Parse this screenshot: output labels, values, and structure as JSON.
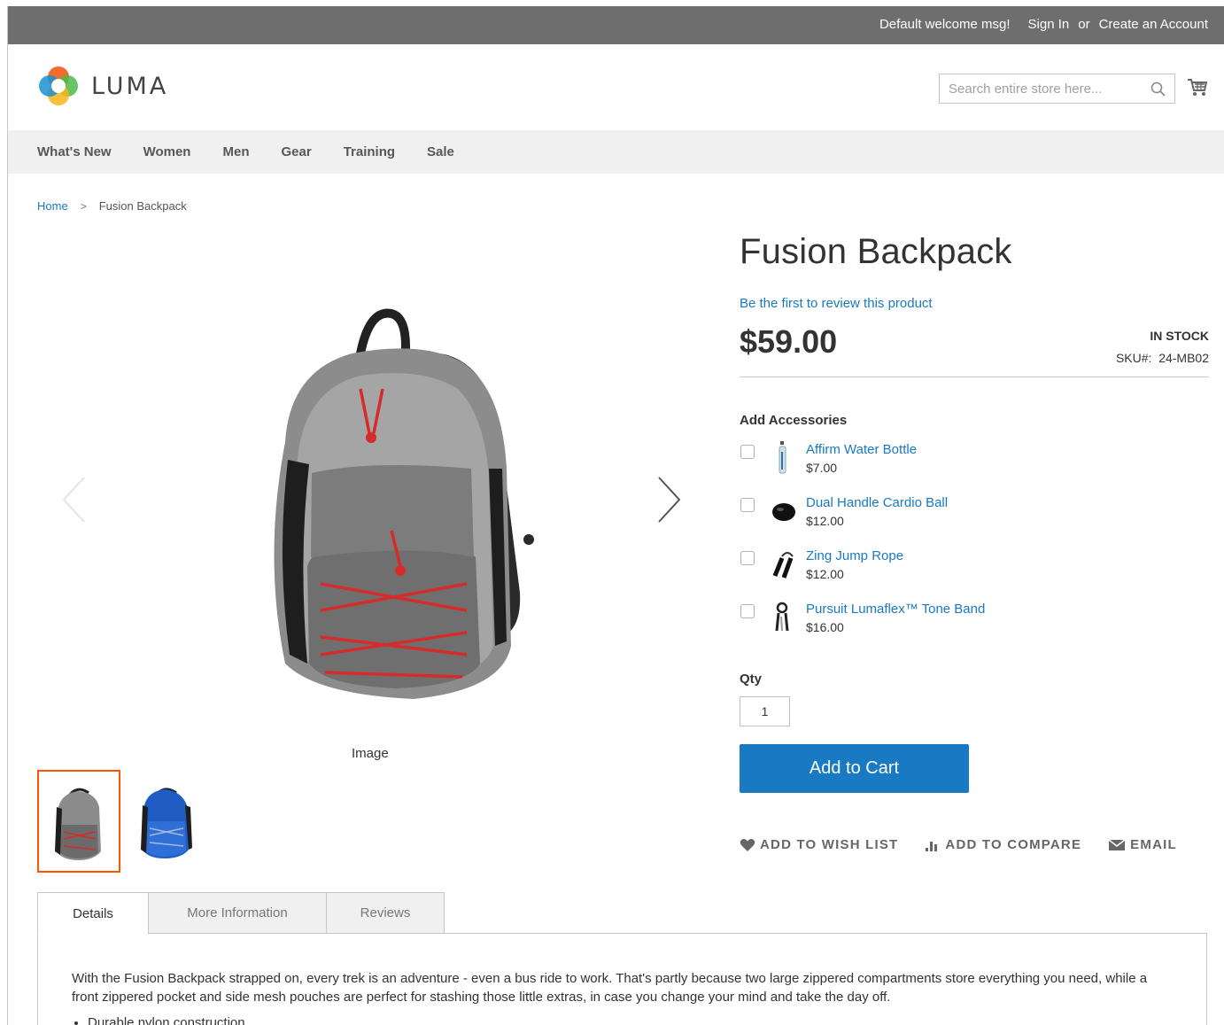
{
  "header": {
    "welcome": "Default welcome msg!",
    "sign_in": "Sign In",
    "or": "or",
    "create_account": "Create an Account",
    "logo_text": "LUMA",
    "search_placeholder": "Search entire store here..."
  },
  "nav": {
    "items": [
      {
        "label": "What's New"
      },
      {
        "label": "Women"
      },
      {
        "label": "Men"
      },
      {
        "label": "Gear"
      },
      {
        "label": "Training"
      },
      {
        "label": "Sale"
      }
    ]
  },
  "breadcrumb": {
    "home": "Home",
    "separator": ">",
    "current": "Fusion Backpack"
  },
  "gallery": {
    "caption": "Image",
    "thumbnails": [
      {
        "icon": "gray-backpack-thumbnail",
        "active": true
      },
      {
        "icon": "blue-backpack-thumbnail",
        "active": false
      }
    ]
  },
  "product": {
    "title": "Fusion Backpack",
    "review_link": "Be the first to review this product",
    "price": "$59.00",
    "stock": "IN STOCK",
    "sku_label": "SKU#:",
    "sku": "24-MB02"
  },
  "accessories": {
    "title": "Add Accessories",
    "items": [
      {
        "name": "Affirm Water Bottle",
        "price": "$7.00",
        "icon": "water-bottle-icon"
      },
      {
        "name": "Dual Handle Cardio Ball",
        "price": "$12.00",
        "icon": "cardio-ball-icon"
      },
      {
        "name": "Zing Jump Rope",
        "price": "$12.00",
        "icon": "jump-rope-icon"
      },
      {
        "name": "Pursuit Lumaflex™ Tone Band",
        "price": "$16.00",
        "icon": "tone-band-icon"
      }
    ]
  },
  "purchase": {
    "qty_label": "Qty",
    "qty_value": "1",
    "add_to_cart": "Add to Cart"
  },
  "actions": {
    "wishlist": "ADD TO WISH LIST",
    "compare": "ADD TO COMPARE",
    "email": "EMAIL"
  },
  "tabs": {
    "items": [
      {
        "label": "Details",
        "active": true
      },
      {
        "label": "More Information",
        "active": false
      },
      {
        "label": "Reviews",
        "active": false
      }
    ],
    "details_text": "With the Fusion Backpack strapped on, every trek is an adventure - even a bus ride to work. That's partly because two large zippered compartments store everything you need, while a front zippered pocket and side mesh pouches are perfect for stashing those little extras, in case you change your mind and take the day off.",
    "first_bullet": "Durable nylon construction."
  },
  "colors": {
    "topbar": "#6e6e6e",
    "link": "#1979c3",
    "primary_button": "#1979c3",
    "active_thumb_border": "#ff5501",
    "nav_bg": "#f0f0f0"
  }
}
